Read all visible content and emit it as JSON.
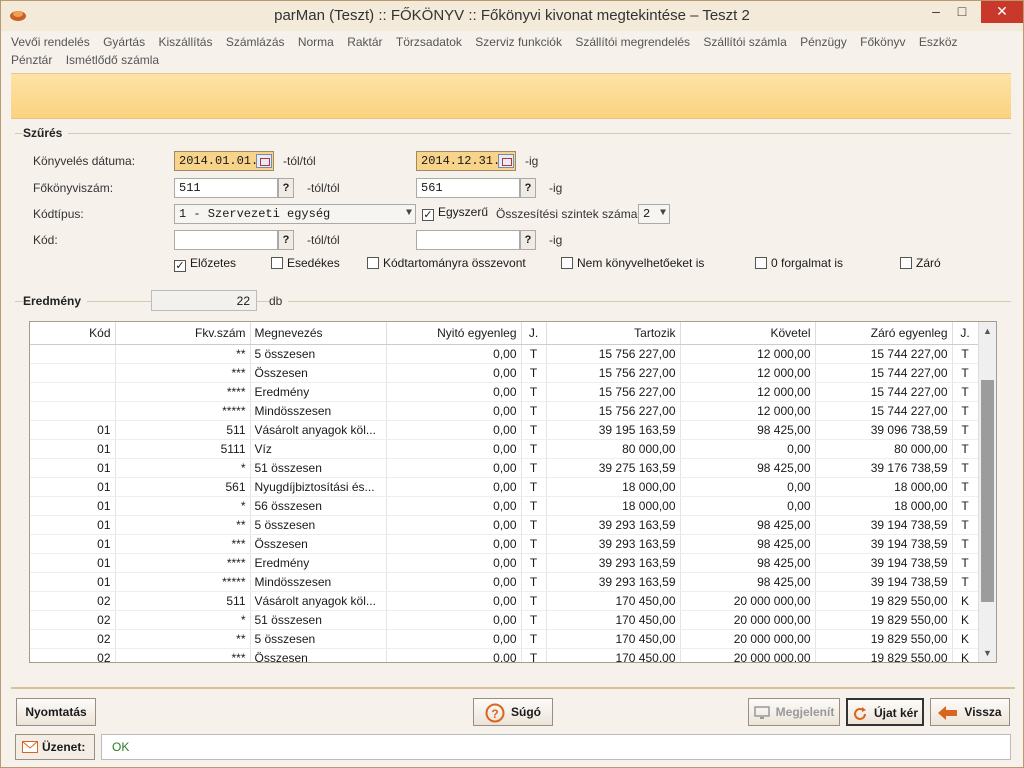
{
  "window": {
    "title": "parMan (Teszt) :: FŐKÖNYV :: Főkönyvi kivonat megtekintése   –   Teszt 2",
    "minimize": "–",
    "maximize": "□",
    "close": "✕"
  },
  "menu": [
    "Vevői rendelés",
    "Gyártás",
    "Kiszállítás",
    "Számlázás",
    "Norma",
    "Raktár",
    "Törzsadatok",
    "Szerviz funkciók",
    "Szállítói megrendelés",
    "Szállítói számla",
    "Pénzügy",
    "Főkönyv",
    "Eszköz",
    "Pénztár",
    "Ismétlődő számla"
  ],
  "filter": {
    "title": "Szűrés",
    "date_label": "Könyvelés dátuma:",
    "date_from": "2014.01.01.",
    "date_to": "2014.12.31.",
    "from_suffix": "-tól/tól",
    "to_suffix": "-ig",
    "account_label": "Főkönyviszám:",
    "account_from": "511",
    "account_to": "561",
    "codetype_label": "Kódtípus:",
    "codetype_value": "1 - Szervezeti egység",
    "simple_label": "Egyszerű",
    "levels_label": "Összesítési szintek száma:",
    "levels_value": "2",
    "code_label": "Kód:",
    "code_from": "",
    "code_to": "",
    "q": "?",
    "checkboxes": [
      {
        "label": "Előzetes",
        "checked": true
      },
      {
        "label": "Esedékes",
        "checked": false
      },
      {
        "label": "Kódtartományra összevont",
        "checked": false
      },
      {
        "label": "Nem könyvelhetőeket is",
        "checked": false
      },
      {
        "label": "0 forgalmat is",
        "checked": false
      },
      {
        "label": "Záró",
        "checked": false
      }
    ]
  },
  "result": {
    "title": "Eredmény",
    "count": "22",
    "unit": "db"
  },
  "table": {
    "columns": [
      "Kód",
      "Fkv.szám",
      "Megnevezés",
      "Nyitó egyenleg",
      "J.",
      "Tartozik",
      "Követel",
      "Záró egyenleg",
      "J."
    ],
    "rows": [
      [
        "",
        "**",
        "5 összesen",
        "0,00",
        "T",
        "15 756 227,00",
        "12 000,00",
        "15 744 227,00",
        "T"
      ],
      [
        "",
        "***",
        "Összesen",
        "0,00",
        "T",
        "15 756 227,00",
        "12 000,00",
        "15 744 227,00",
        "T"
      ],
      [
        "",
        "****",
        "Eredmény",
        "0,00",
        "T",
        "15 756 227,00",
        "12 000,00",
        "15 744 227,00",
        "T"
      ],
      [
        "",
        "*****",
        "Mindösszesen",
        "0,00",
        "T",
        "15 756 227,00",
        "12 000,00",
        "15 744 227,00",
        "T"
      ],
      [
        "01",
        "511",
        "Vásárolt anyagok köl...",
        "0,00",
        "T",
        "39 195 163,59",
        "98 425,00",
        "39 096 738,59",
        "T"
      ],
      [
        "01",
        "5111",
        "Víz",
        "0,00",
        "T",
        "80 000,00",
        "0,00",
        "80 000,00",
        "T"
      ],
      [
        "01",
        "*",
        "51 összesen",
        "0,00",
        "T",
        "39 275 163,59",
        "98 425,00",
        "39 176 738,59",
        "T"
      ],
      [
        "01",
        "561",
        " Nyugdíjbiztosítási és...",
        "0,00",
        "T",
        "18 000,00",
        "0,00",
        "18 000,00",
        "T"
      ],
      [
        "01",
        "*",
        "56 összesen",
        "0,00",
        "T",
        "18 000,00",
        "0,00",
        "18 000,00",
        "T"
      ],
      [
        "01",
        "**",
        "5 összesen",
        "0,00",
        "T",
        "39 293 163,59",
        "98 425,00",
        "39 194 738,59",
        "T"
      ],
      [
        "01",
        "***",
        "Összesen",
        "0,00",
        "T",
        "39 293 163,59",
        "98 425,00",
        "39 194 738,59",
        "T"
      ],
      [
        "01",
        "****",
        "Eredmény",
        "0,00",
        "T",
        "39 293 163,59",
        "98 425,00",
        "39 194 738,59",
        "T"
      ],
      [
        "01",
        "*****",
        "Mindösszesen",
        "0,00",
        "T",
        "39 293 163,59",
        "98 425,00",
        "39 194 738,59",
        "T"
      ],
      [
        "02",
        "511",
        "Vásárolt anyagok köl...",
        "0,00",
        "T",
        "170 450,00",
        "20 000 000,00",
        "19 829 550,00",
        "K"
      ],
      [
        "02",
        "*",
        "51 összesen",
        "0,00",
        "T",
        "170 450,00",
        "20 000 000,00",
        "19 829 550,00",
        "K"
      ],
      [
        "02",
        "**",
        "5 összesen",
        "0,00",
        "T",
        "170 450,00",
        "20 000 000,00",
        "19 829 550,00",
        "K"
      ],
      [
        "02",
        "***",
        "Összesen",
        "0,00",
        "T",
        "170 450,00",
        "20 000 000,00",
        "19 829 550,00",
        "K"
      ]
    ]
  },
  "buttons": {
    "print": "Nyomtatás",
    "help": "Súgó",
    "display": "Megjelenít",
    "new_request": "Újat kér",
    "back": "Vissza"
  },
  "status": {
    "label": "Üzenet:",
    "message": "OK"
  }
}
